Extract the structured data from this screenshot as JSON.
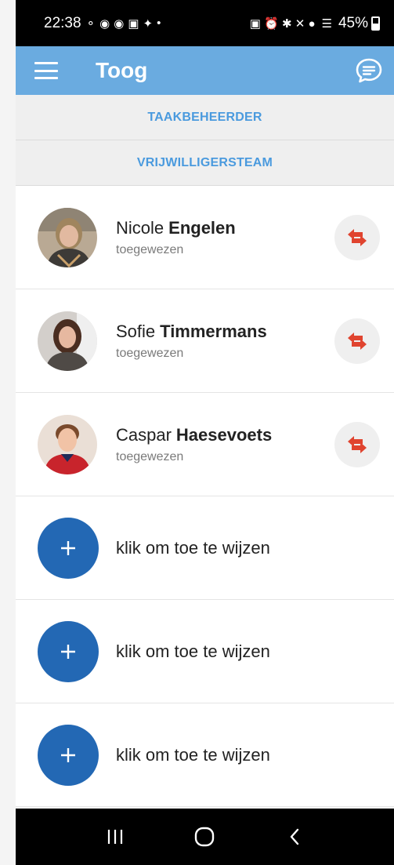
{
  "status_bar": {
    "time": "22:38",
    "battery_percent": "45%"
  },
  "app_bar": {
    "title": "Toog",
    "menu_icon": "hamburger-menu-icon",
    "chat_icon": "chat-bubble-icon"
  },
  "tabs": [
    {
      "label": "TAAKBEHEERDER"
    },
    {
      "label": "VRIJWILLIGERSTEAM"
    }
  ],
  "assigned": [
    {
      "first_name": "Nicole",
      "last_name": "Engelen",
      "status": "toegewezen"
    },
    {
      "first_name": "Sofie",
      "last_name": "Timmermans",
      "status": "toegewezen"
    },
    {
      "first_name": "Caspar",
      "last_name": "Haesevoets",
      "status": "toegewezen"
    }
  ],
  "open_slots": [
    {
      "label": "klik om toe te wijzen"
    },
    {
      "label": "klik om toe te wijzen"
    },
    {
      "label": "klik om toe te wijzen"
    }
  ],
  "colors": {
    "app_bar": "#6aabe0",
    "tab_text": "#4a9ade",
    "swap_arrows": "#e0442f",
    "add_button": "#2368b4"
  }
}
